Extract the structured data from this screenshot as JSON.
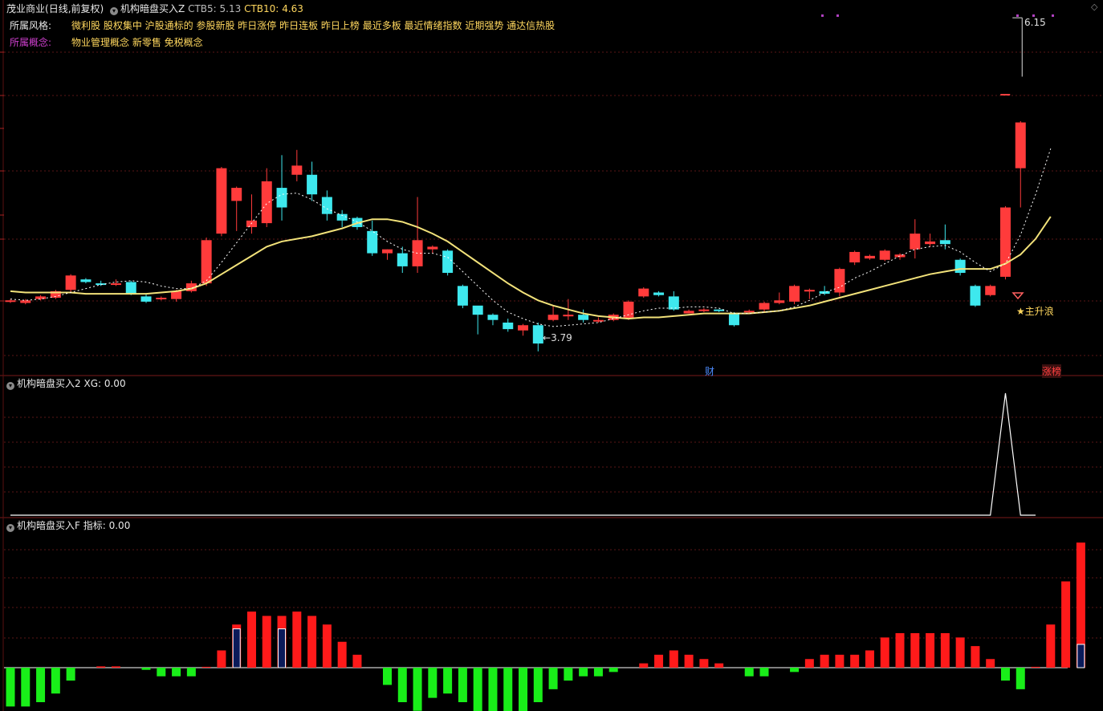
{
  "header": {
    "stock_name": "茂业商业",
    "period": "(日线,前复权)",
    "indicator_name": "机构暗盘买入Z",
    "ctb5_label": "CTB5:",
    "ctb5_value": "5.13",
    "ctb10_label": "CTB10:",
    "ctb10_value": "4.63"
  },
  "info": {
    "style_label": "所属风格:",
    "style_tags": "微利股 股权集中 沪股通标的 参股新股 昨日涨停 昨日连板 昨日上榜 最近多板 最近情绪指数 近期强势 通达信热股",
    "concept_label": "所属概念:",
    "concept_tags": "物业管理概念 新零售 免税概念"
  },
  "price_panel": {
    "high_label": "6.15",
    "low_label": "3.79",
    "signal_label": "★主升浪",
    "marker_cai": "财",
    "marker_zhangbang": "涨榜",
    "colors": {
      "up": "#ff3b3b",
      "down": "#3ee8ee",
      "ma5": "#ffffff",
      "ma10": "#f2e27a"
    }
  },
  "xg_panel": {
    "title": "机构暗盘买入2",
    "label": "XG:",
    "value": "0.00"
  },
  "f_panel": {
    "title": "机构暗盘买入F",
    "label": "指标:",
    "value": "0.00"
  },
  "chart_data": [
    {
      "type": "candlestick",
      "title": "机构暗盘买入Z",
      "candles": [
        [
          3.98,
          3.99,
          3.97,
          4.0
        ],
        [
          3.97,
          3.99,
          3.96,
          4.0
        ],
        [
          4.0,
          4.02,
          3.99,
          4.03
        ],
        [
          4.01,
          4.06,
          4.0,
          4.07
        ],
        [
          4.07,
          4.18,
          4.05,
          4.19
        ],
        [
          4.15,
          4.13,
          4.12,
          4.16
        ],
        [
          4.12,
          4.11,
          4.1,
          4.14
        ],
        [
          4.11,
          4.12,
          4.1,
          4.15
        ],
        [
          4.13,
          4.04,
          4.03,
          4.14
        ],
        [
          4.02,
          3.98,
          3.97,
          4.04
        ],
        [
          4.0,
          4.01,
          3.99,
          4.02
        ],
        [
          4.0,
          4.06,
          3.98,
          4.07
        ],
        [
          4.06,
          4.12,
          4.05,
          4.14
        ],
        [
          4.12,
          4.45,
          4.1,
          4.47
        ],
        [
          4.5,
          5.0,
          4.48,
          5.01
        ],
        [
          4.75,
          4.85,
          4.52,
          4.86
        ],
        [
          4.55,
          4.6,
          4.5,
          4.8
        ],
        [
          4.58,
          4.9,
          4.55,
          5.0
        ],
        [
          4.85,
          4.7,
          4.6,
          5.1
        ],
        [
          4.95,
          5.02,
          4.9,
          5.14
        ],
        [
          4.95,
          4.8,
          4.75,
          5.05
        ],
        [
          4.78,
          4.65,
          4.6,
          4.83
        ],
        [
          4.65,
          4.6,
          4.55,
          4.68
        ],
        [
          4.62,
          4.55,
          4.53,
          4.63
        ],
        [
          4.52,
          4.35,
          4.33,
          4.6
        ],
        [
          4.35,
          4.38,
          4.3,
          4.38
        ],
        [
          4.35,
          4.25,
          4.2,
          4.4
        ],
        [
          4.25,
          4.45,
          4.2,
          4.78
        ],
        [
          4.38,
          4.4,
          4.35,
          4.41
        ],
        [
          4.37,
          4.2,
          4.18,
          4.38
        ],
        [
          4.1,
          3.95,
          3.93,
          4.11
        ],
        [
          3.95,
          3.88,
          3.73,
          3.94
        ],
        [
          3.88,
          3.84,
          3.8,
          3.89
        ],
        [
          3.82,
          3.77,
          3.75,
          3.85
        ],
        [
          3.76,
          3.8,
          3.72,
          3.81
        ],
        [
          3.8,
          3.66,
          3.6,
          3.82
        ],
        [
          3.84,
          3.88,
          3.83,
          3.95
        ],
        [
          3.87,
          3.88,
          3.84,
          4.0
        ],
        [
          3.88,
          3.84,
          3.82,
          3.92
        ],
        [
          3.84,
          3.84,
          3.82,
          3.86
        ],
        [
          3.84,
          3.88,
          3.83,
          3.89
        ],
        [
          3.85,
          3.98,
          3.84,
          3.99
        ],
        [
          4.02,
          4.08,
          4.01,
          4.09
        ],
        [
          4.05,
          4.03,
          4.02,
          4.06
        ],
        [
          4.02,
          3.92,
          3.91,
          4.06
        ],
        [
          3.89,
          3.91,
          3.89,
          3.92
        ],
        [
          3.91,
          3.92,
          3.9,
          3.93
        ],
        [
          3.92,
          3.91,
          3.9,
          3.92
        ],
        [
          3.89,
          3.8,
          3.79,
          3.9
        ],
        [
          3.9,
          3.91,
          3.89,
          3.92
        ],
        [
          3.92,
          3.97,
          3.9,
          3.98
        ],
        [
          3.97,
          3.99,
          3.96,
          4.05
        ],
        [
          3.98,
          4.1,
          3.96,
          4.11
        ],
        [
          4.06,
          4.07,
          4.0,
          4.08
        ],
        [
          4.06,
          4.04,
          4.03,
          4.1
        ],
        [
          4.05,
          4.23,
          4.02,
          4.24
        ],
        [
          4.28,
          4.36,
          4.26,
          4.37
        ],
        [
          4.31,
          4.33,
          4.3,
          4.34
        ],
        [
          4.3,
          4.37,
          4.29,
          4.38
        ],
        [
          4.32,
          4.34,
          4.3,
          4.35
        ],
        [
          4.38,
          4.5,
          4.31,
          4.61
        ],
        [
          4.42,
          4.44,
          4.4,
          4.5
        ],
        [
          4.45,
          4.42,
          4.38,
          4.57
        ],
        [
          4.3,
          4.2,
          4.18,
          4.31
        ],
        [
          4.1,
          3.95,
          3.94,
          4.11
        ],
        [
          4.03,
          4.1,
          4.02,
          4.11
        ],
        [
          4.17,
          4.7,
          4.15,
          4.71
        ],
        [
          5.0,
          5.35,
          4.7,
          5.36
        ]
      ],
      "ma5": [
        4.0,
        3.99,
        4.0,
        4.02,
        4.05,
        4.08,
        4.11,
        4.13,
        4.14,
        4.13,
        4.1,
        4.08,
        4.08,
        4.14,
        4.28,
        4.43,
        4.58,
        4.73,
        4.8,
        4.81,
        4.76,
        4.69,
        4.64,
        4.59,
        4.52,
        4.44,
        4.38,
        4.35,
        4.35,
        4.32,
        4.21,
        4.1,
        3.99,
        3.9,
        3.85,
        3.81,
        3.79,
        3.8,
        3.81,
        3.82,
        3.85,
        3.88,
        3.91,
        3.93,
        3.93,
        3.94,
        3.94,
        3.93,
        3.89,
        3.89,
        3.9,
        3.91,
        3.94,
        3.99,
        4.05,
        4.09,
        4.16,
        4.21,
        4.27,
        4.33,
        4.38,
        4.4,
        4.41,
        4.36,
        4.28,
        4.21,
        4.27,
        4.49,
        4.8,
        5.15
      ],
      "ma10": [
        4.06,
        4.05,
        4.05,
        4.05,
        4.05,
        4.04,
        4.04,
        4.04,
        4.04,
        4.04,
        4.05,
        4.06,
        4.08,
        4.12,
        4.19,
        4.26,
        4.33,
        4.4,
        4.44,
        4.46,
        4.48,
        4.51,
        4.54,
        4.58,
        4.61,
        4.61,
        4.59,
        4.55,
        4.5,
        4.44,
        4.36,
        4.28,
        4.2,
        4.12,
        4.05,
        3.99,
        3.95,
        3.92,
        3.89,
        3.87,
        3.86,
        3.85,
        3.86,
        3.86,
        3.87,
        3.88,
        3.89,
        3.89,
        3.89,
        3.89,
        3.9,
        3.91,
        3.93,
        3.95,
        3.98,
        4.01,
        4.04,
        4.07,
        4.1,
        4.13,
        4.16,
        4.19,
        4.21,
        4.23,
        4.23,
        4.23,
        4.27,
        4.34,
        4.46,
        4.63
      ],
      "ylim": [
        3.55,
        6.2
      ]
    },
    {
      "type": "line",
      "title": "机构暗盘买入2",
      "series": [
        {
          "name": "XG",
          "values": [
            0,
            0,
            0,
            0,
            0,
            0,
            0,
            0,
            0,
            0,
            0,
            0,
            0,
            0,
            0,
            0,
            0,
            0,
            0,
            0,
            0,
            0,
            0,
            0,
            0,
            0,
            0,
            0,
            0,
            0,
            0,
            0,
            0,
            0,
            0,
            0,
            0,
            0,
            0,
            0,
            0,
            0,
            0,
            0,
            0,
            0,
            0,
            0,
            0,
            0,
            0,
            0,
            0,
            0,
            0,
            0,
            0,
            0,
            0,
            0,
            0,
            0,
            0,
            0,
            0,
            0,
            1,
            0,
            0
          ]
        }
      ],
      "ylim": [
        0,
        1
      ]
    },
    {
      "type": "bar",
      "title": "机构暗盘买入F",
      "series": [
        {
          "name": "指标",
          "values": [
            -9,
            -9,
            -8,
            -6,
            -3,
            0,
            0.3,
            0.3,
            0,
            -0.5,
            -2,
            -2,
            -2,
            0.2,
            4,
            10,
            13,
            12,
            12,
            13,
            12,
            10,
            6,
            3,
            0,
            -4,
            -8,
            -10,
            -7,
            -6,
            -8,
            -11,
            -12,
            -13,
            -11,
            -8,
            -5,
            -3,
            -2,
            -2,
            -1,
            0,
            1,
            3,
            4,
            3,
            2,
            1,
            0,
            -2,
            -2,
            0,
            -1,
            2,
            3,
            3,
            3,
            4,
            7,
            8,
            8,
            8,
            8,
            7,
            5,
            2,
            -3,
            -5,
            0.2,
            10,
            20,
            29
          ]
        }
      ],
      "overlay_values": [
        0,
        0,
        0,
        0,
        0,
        0,
        0,
        0,
        0,
        0,
        0,
        0,
        0,
        0,
        0,
        10,
        0,
        0,
        10,
        0,
        0,
        0,
        0,
        0,
        0,
        0,
        0,
        0,
        0,
        0,
        0,
        0,
        0,
        0,
        0,
        0,
        0,
        0,
        0,
        0,
        0,
        0,
        0,
        0,
        0,
        0,
        0,
        0,
        0,
        0,
        0,
        0,
        0,
        0,
        0,
        0,
        0,
        0,
        0,
        0,
        0,
        0,
        0,
        0,
        0,
        0,
        0,
        0,
        0,
        0,
        0,
        6
      ],
      "ylim": [
        -15,
        32
      ]
    }
  ]
}
